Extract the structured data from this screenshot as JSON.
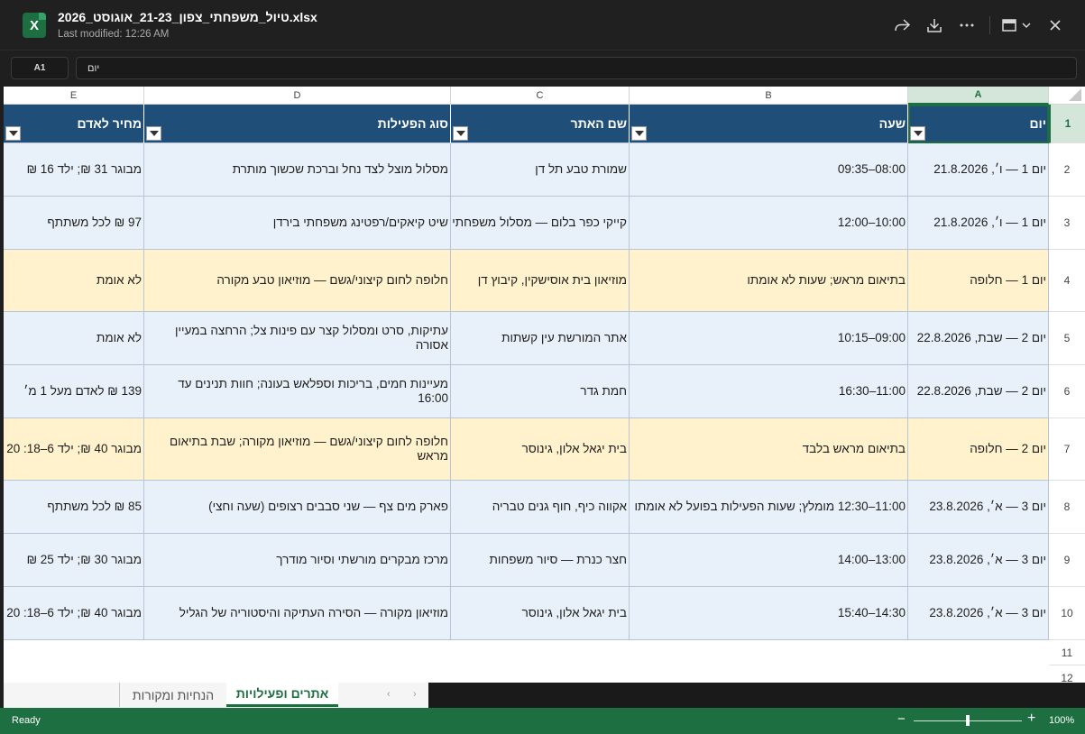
{
  "titlebar": {
    "file_name": "טיול_משפחתי_צפון_21-23_אוגוסט_2026.xlsx",
    "last_modified": "Last modified: 12:26 AM"
  },
  "formula_bar": {
    "cell_ref": "A1",
    "content": "יום"
  },
  "columns": [
    "E",
    "D",
    "C",
    "B",
    "A"
  ],
  "table": {
    "headers": {
      "A": "יום",
      "B": "שעה",
      "C": "שם האתר",
      "D": "סוג הפעילות",
      "E": "מחיר לאדם"
    },
    "rows": [
      {
        "num": "2",
        "A": "יום 1 — ו׳, 21.8.2026",
        "B": "08:00–09:35",
        "C": "שמורת טבע תל דן",
        "D": "מסלול מוצל לצד נחל וברכת שכשוך מותרת",
        "E": "מבוגר 31 ₪; ילד 16 ₪"
      },
      {
        "num": "3",
        "A": "יום 1 — ו׳, 21.8.2026",
        "B": "10:00–12:00",
        "C": "קייקי כפר בלום — מסלול משפחתי",
        "D": "שיט קיאקים/רפטינג משפחתי בירדן",
        "E": "97 ₪ לכל משתתף"
      },
      {
        "num": "4",
        "A": "יום 1 — חלופה",
        "B": "בתיאום מראש; שעות לא אומתו",
        "C": "מוזיאון בית אוסישקין, קיבוץ דן",
        "D": "חלופה לחום קיצוני/גשם — מוזיאון טבע מקורה",
        "E": "לא אומת"
      },
      {
        "num": "5",
        "A": "יום 2 — שבת, 22.8.2026",
        "B": "09:00–10:15",
        "C": "אתר המורשת עין קשתות",
        "D": "עתיקות, סרט ומסלול קצר עם פינות צל; הרחצה במעיין אסורה",
        "E": "לא אומת"
      },
      {
        "num": "6",
        "A": "יום 2 — שבת, 22.8.2026",
        "B": "11:00–16:30",
        "C": "חמת גדר",
        "D": "מעיינות חמים, בריכות וספלאש בעונה; חוות תנינים עד 16:00",
        "E": "139 ₪ לאדם מעל 1 מ׳"
      },
      {
        "num": "7",
        "A": "יום 2 — חלופה",
        "B": "בתיאום מראש בלבד",
        "C": "בית יגאל אלון, גינוסר",
        "D": "חלופה לחום קיצוני/גשם — מוזיאון מקורה; שבת בתיאום מראש",
        "E": "מבוגר 40 ₪; ילד 6–18: 20"
      },
      {
        "num": "8",
        "A": "יום 3 — א׳, 23.8.2026",
        "B": "11:00–12:30 מומלץ; שעות הפעילות בפועל לא אומתו",
        "C": "אקווה כיף, חוף גנים טבריה",
        "D": "פארק מים צף — שני סבבים רצופים (שעה וחצי)",
        "E": "85 ₪ לכל משתתף"
      },
      {
        "num": "9",
        "A": "יום 3 — א׳, 23.8.2026",
        "B": "13:00–14:00",
        "C": "חצר כנרת — סיור משפחות",
        "D": "מרכז מבקרים מורשתי וסיור מודרך",
        "E": "מבוגר 30 ₪; ילד 25 ₪"
      },
      {
        "num": "10",
        "A": "יום 3 — א׳, 23.8.2026",
        "B": "14:30–15:40",
        "C": "בית יגאל אלון, גינוסר",
        "D": "מוזיאון מקורה — הסירה העתיקה והיסטוריה של הגליל",
        "E": "מבוגר 40 ₪; ילד 6–18: 20"
      }
    ],
    "empty_rows": [
      "11",
      "12"
    ]
  },
  "sheet_tabs": {
    "active": "אתרים ופעילויות",
    "inactive": "הנחיות ומקורות"
  },
  "status": {
    "ready": "Ready",
    "zoom": "100%"
  },
  "colors": {
    "header_bg": "#1f4e79",
    "row_blue": "#e8f1f9",
    "row_yellow": "#fff2cc",
    "accent_green": "#1d6f42"
  }
}
